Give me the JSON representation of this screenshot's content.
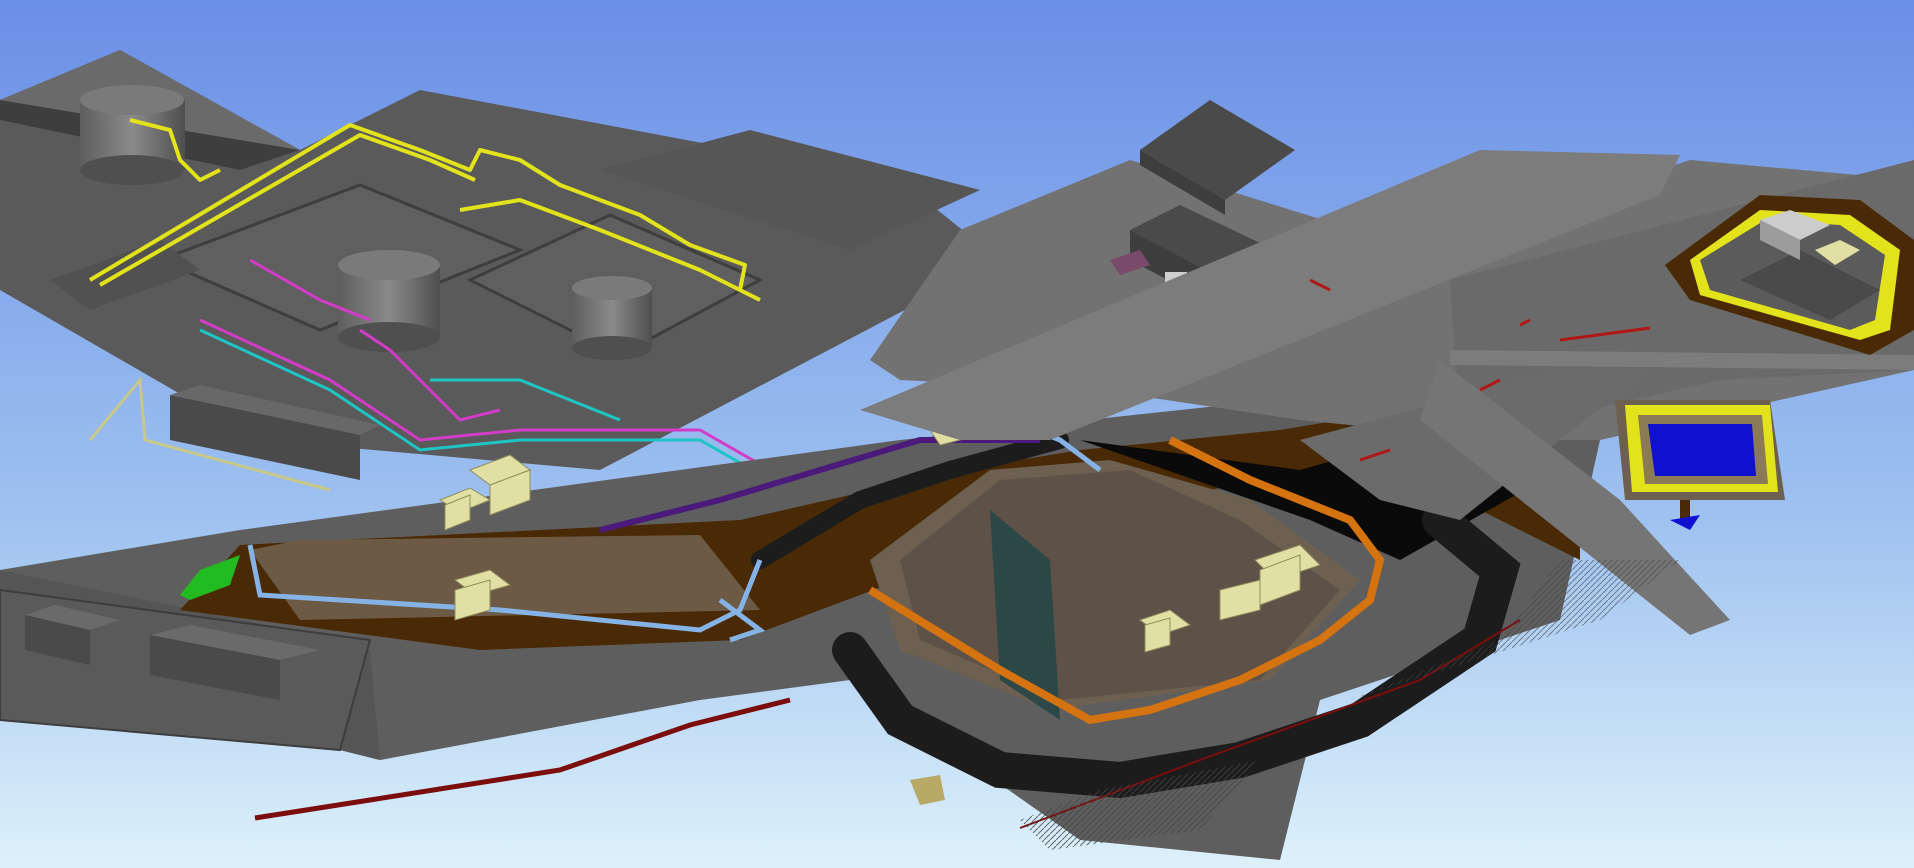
{
  "viewport": {
    "background_top": "#6A8FE6",
    "background_bottom": "#DDF1FA"
  },
  "colors": {
    "ground": "#5C5C5C",
    "ground_light": "#727272",
    "slab": "#555555",
    "road": "#1C1C1C",
    "dirt": "#4A2A06",
    "sand": "#7B6A50",
    "pipe_yellow": "#E3E31B",
    "pipe_magenta": "#D23CC8",
    "pipe_cyan": "#1DC5C5",
    "pipe_orange": "#D4730F",
    "pipe_red": "#7C0D0D",
    "pipe_purple": "#4B1A7A",
    "pipe_blue": "#86B3E6",
    "equipment": "#E2DFA4",
    "water": "#1010D0",
    "grass": "#22BB22",
    "tank": "#6E6E6E",
    "label_text": "#20D6D6"
  },
  "scene": {
    "tank_labels": [
      "",
      "",
      ""
    ],
    "building_labels": [
      "",
      "",
      "",
      ""
    ]
  }
}
